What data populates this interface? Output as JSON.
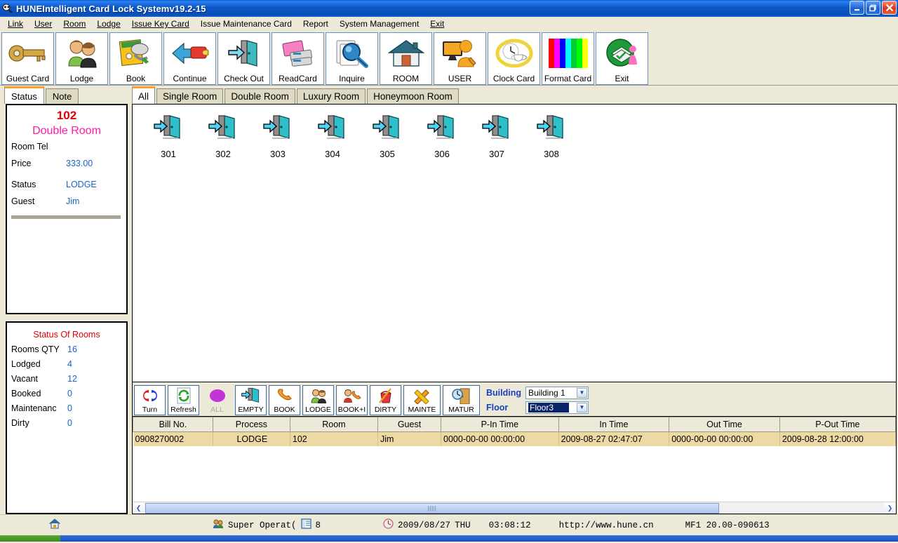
{
  "window": {
    "title": "HUNEIntelligent Card Lock Systemv19.2-15",
    "app_icon": "lock-icon",
    "minimize_label": "–",
    "maximize_label": "❐",
    "close_label": "✕"
  },
  "menubar": {
    "items": [
      {
        "label": "Link",
        "accel": "L"
      },
      {
        "label": "User",
        "accel": "U"
      },
      {
        "label": "Room",
        "accel": "R"
      },
      {
        "label": "Lodge",
        "accel": "L"
      },
      {
        "label": "Issue Key Card",
        "accel": "I"
      },
      {
        "label": "Issue Maintenance Card",
        "accel": "I"
      },
      {
        "label": "Report",
        "accel": "R"
      },
      {
        "label": "System Management",
        "accel": "S"
      },
      {
        "label": "Exit",
        "accel": "E"
      }
    ]
  },
  "toolbar": {
    "buttons": [
      {
        "label": "Guest Card",
        "icon": "key-icon"
      },
      {
        "label": "Lodge",
        "icon": "two-people-icon"
      },
      {
        "label": "Book",
        "icon": "contact-book-phone-icon"
      },
      {
        "label": "Continue",
        "icon": "arrow-battery-icon"
      },
      {
        "label": "Check Out",
        "icon": "exit-door-arrow-icon"
      },
      {
        "label": "ReadCard",
        "icon": "pink-card-reader-icon"
      },
      {
        "label": "Inquire",
        "icon": "magnifier-icon"
      },
      {
        "label": "ROOM",
        "icon": "house-icon"
      },
      {
        "label": "USER",
        "icon": "monitor-user-icon"
      },
      {
        "label": "Clock Card",
        "icon": "clock-cup-icon"
      },
      {
        "label": "Format Card",
        "icon": "color-bars-icon"
      },
      {
        "label": "Exit",
        "icon": "green-exit-person-icon"
      }
    ]
  },
  "left_panel": {
    "tabs": [
      {
        "label": "Status",
        "active": true
      },
      {
        "label": "Note",
        "active": false
      }
    ],
    "room_detail": {
      "room_number": "102",
      "room_type": "Double Room",
      "fields": [
        {
          "key": "Room Tel",
          "value": ""
        },
        {
          "key": "Price",
          "value": "333.00"
        },
        {
          "key": "Status",
          "value": "LODGE"
        },
        {
          "key": "Guest",
          "value": "Jim"
        }
      ]
    },
    "room_status": {
      "title": "Status Of Rooms",
      "rows": [
        {
          "key": "Rooms QTY",
          "value": "16"
        },
        {
          "key": "Lodged",
          "value": "4"
        },
        {
          "key": "Vacant",
          "value": "12"
        },
        {
          "key": "Booked",
          "value": "0"
        },
        {
          "key": "Maintenanc",
          "value": "0"
        },
        {
          "key": "Dirty",
          "value": "0"
        }
      ]
    }
  },
  "main": {
    "tabs": [
      {
        "label": "All",
        "active": true
      },
      {
        "label": "Single Room",
        "active": false
      },
      {
        "label": "Double Room",
        "active": false
      },
      {
        "label": "Luxury Room",
        "active": false
      },
      {
        "label": "Honeymoon Room",
        "active": false
      }
    ],
    "rooms": [
      {
        "number": "301",
        "icon": "door-arrow-icon"
      },
      {
        "number": "302",
        "icon": "door-arrow-icon"
      },
      {
        "number": "303",
        "icon": "door-arrow-icon"
      },
      {
        "number": "304",
        "icon": "door-arrow-icon"
      },
      {
        "number": "305",
        "icon": "door-arrow-icon"
      },
      {
        "number": "306",
        "icon": "door-arrow-icon"
      },
      {
        "number": "307",
        "icon": "door-arrow-icon"
      },
      {
        "number": "308",
        "icon": "door-arrow-icon"
      }
    ]
  },
  "bottom_toolbar": {
    "buttons": [
      {
        "label": "Turn",
        "icon": "turn-arrows-icon",
        "disabled": false
      },
      {
        "label": "Refresh",
        "icon": "refresh-icon",
        "disabled": false
      },
      {
        "label": "ALL",
        "icon": "purple-circle-icon",
        "disabled": true
      },
      {
        "label": "EMPTY",
        "icon": "door-arrow-icon",
        "disabled": false
      },
      {
        "label": "BOOK",
        "icon": "phone-icon",
        "disabled": false
      },
      {
        "label": "LODGE",
        "icon": "two-people-icon",
        "disabled": false
      },
      {
        "label": "BOOK+I",
        "icon": "person-phone-icon",
        "disabled": false
      },
      {
        "label": "DIRTY",
        "icon": "bucket-broom-icon",
        "disabled": false
      },
      {
        "label": "MAINTE",
        "icon": "hammer-wrench-icon",
        "disabled": false
      },
      {
        "label": "MATUR",
        "icon": "clock-door-icon",
        "disabled": false
      }
    ],
    "building_label": "Building",
    "building_value": "Building 1",
    "floor_label": "Floor",
    "floor_value": "Floor3"
  },
  "grid": {
    "columns": [
      "Bill No.",
      "Process",
      "Room",
      "Guest",
      "P-In Time",
      "In Time",
      "Out Time",
      "P-Out Time"
    ],
    "rows": [
      {
        "bill_no": "0908270002",
        "process": "LODGE",
        "room": "102",
        "guest": "Jim",
        "p_in_time": "0000-00-00 00:00:00",
        "in_time": "2009-08-27 02:47:07",
        "out_time": "0000-00-00 00:00:00",
        "p_out_time": "2009-08-28 12:00:00"
      }
    ],
    "scroll_left_label": "❮",
    "scroll_right_label": "❯"
  },
  "statusbar": {
    "home_icon": "house-icon",
    "user_icon": "users-icon",
    "user_text": "Super Operat(",
    "doc_icon": "list-icon",
    "doc_count": "8",
    "clock_icon": "clock-icon",
    "date": "2009/08/27",
    "weekday": "THU",
    "time": "03:08:12",
    "url": "http://www.hune.cn",
    "version": "MF1 20.00-090613"
  }
}
